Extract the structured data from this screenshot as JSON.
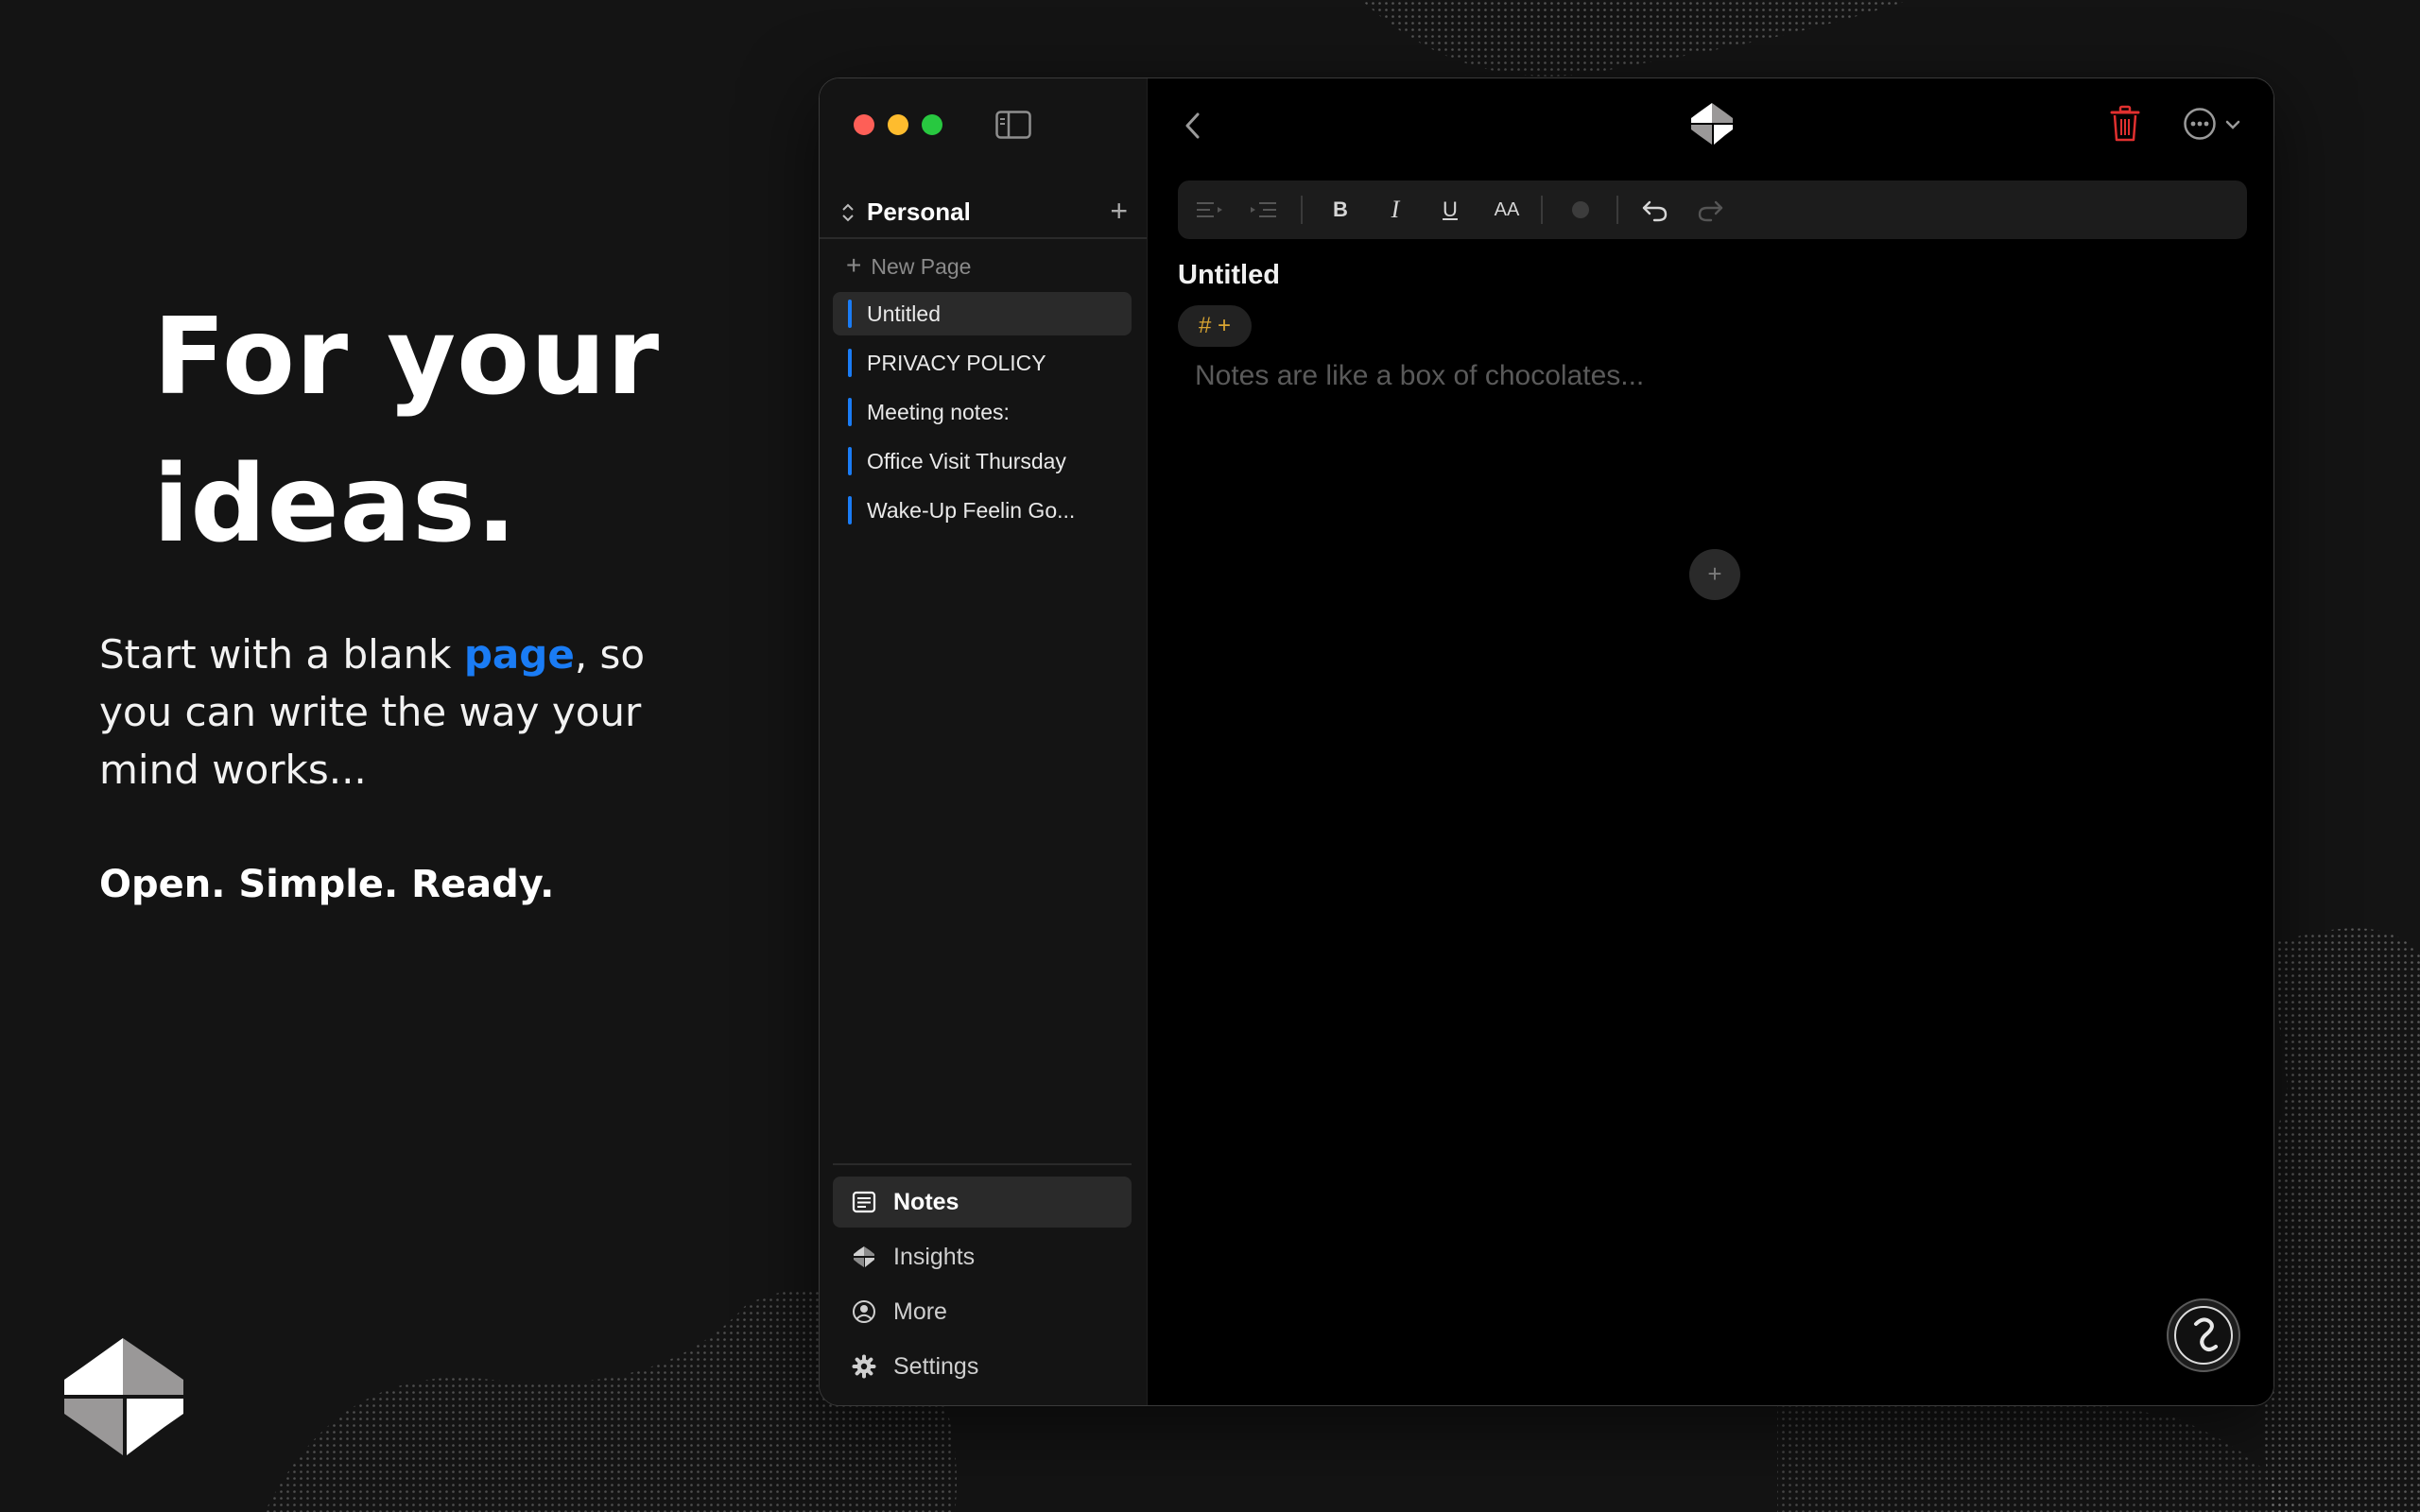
{
  "marketing": {
    "headline_line1": "For your",
    "headline_line2": "ideas.",
    "subcopy_before": "Start with a blank ",
    "subcopy_accent": "page",
    "subcopy_after": ", so you can write the way your mind works...",
    "tagline": "Open. Simple. Ready."
  },
  "colors": {
    "accent": "#1a7cf5",
    "background": "#141414",
    "trash": "#e0302f",
    "tag": "#d9a532"
  },
  "sidebar": {
    "workspace": "Personal",
    "new_page_label": "New Page",
    "pages": [
      {
        "title": "Untitled",
        "active": true
      },
      {
        "title": "PRIVACY POLICY"
      },
      {
        "title": "Meeting notes:"
      },
      {
        "title": "Office Visit Thursday"
      },
      {
        "title": "Wake-Up Feelin Go..."
      }
    ],
    "nav": [
      {
        "label": "Notes",
        "icon": "notes-icon",
        "active": true
      },
      {
        "label": "Insights",
        "icon": "insights-icon"
      },
      {
        "label": "More",
        "icon": "user-circle-icon"
      },
      {
        "label": "Settings",
        "icon": "gear-icon"
      }
    ]
  },
  "editor": {
    "toolbar": [
      "align-left",
      "indent",
      "bold",
      "italic",
      "underline",
      "text-size",
      "color",
      "undo",
      "redo"
    ],
    "bold_label": "B",
    "italic_label": "I",
    "underline_label": "U",
    "text_size_label": "AA",
    "title": "Untitled",
    "tag_label": "# +",
    "placeholder": "Notes are like a box of chocolates...",
    "add_block_label": "+"
  }
}
